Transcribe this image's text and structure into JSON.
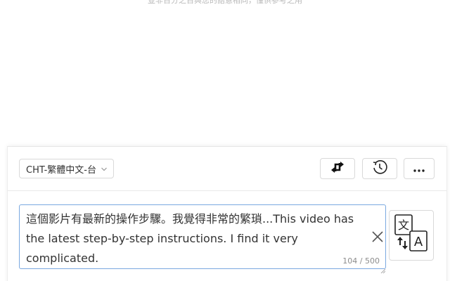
{
  "notice": {
    "text": "並非百分之百與您的語意相同，僅供參考之用"
  },
  "toolbar": {
    "language_label": "CHT-繁體中文-台",
    "swap_icon": "swap-arrows-icon",
    "history_icon": "history-icon",
    "more_icon": "more-dots-icon"
  },
  "input": {
    "text": "這個影片有最新的操作步驟。我覺得非常的繁瑣...This video has the latest step-by-step instructions. I find it very complicated.",
    "counter": "104 / 500",
    "clear_icon": "close-icon"
  },
  "translate": {
    "icon": "translate-icon"
  },
  "colors": {
    "border": "#d9d9d9",
    "focus_border": "#7aa8e0",
    "text": "#333333",
    "muted": "#8c8c8c"
  }
}
